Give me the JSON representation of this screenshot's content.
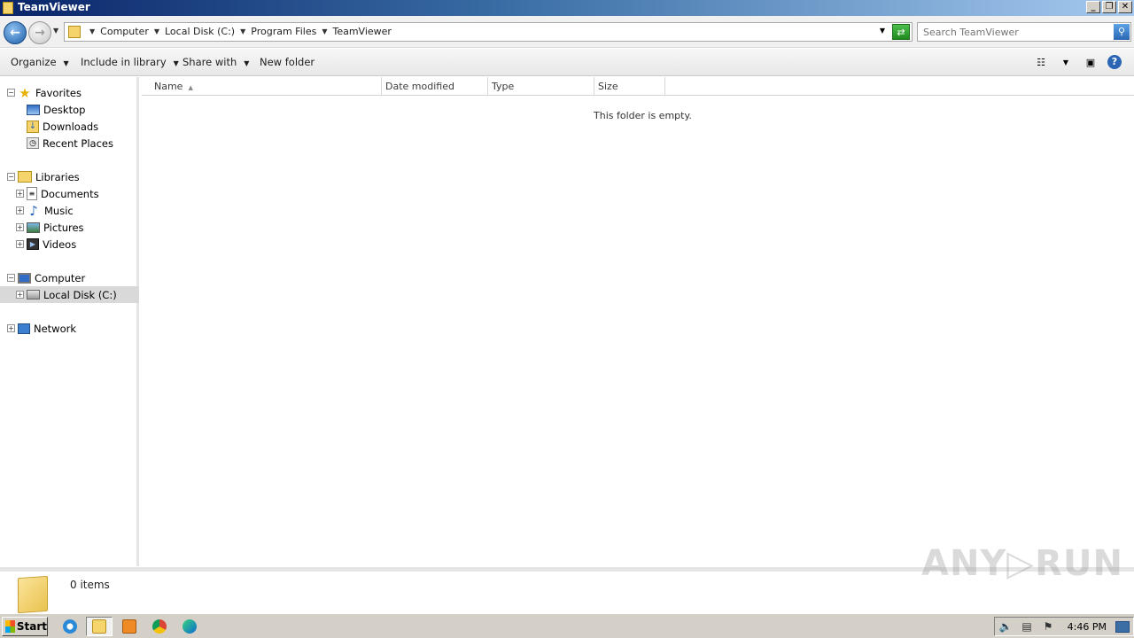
{
  "window": {
    "title": "TeamViewer",
    "buttons": {
      "minimize": "_",
      "restore": "❐",
      "close": "✕"
    }
  },
  "address": {
    "crumbs": [
      "Computer",
      "Local Disk (C:)",
      "Program Files",
      "TeamViewer"
    ],
    "search_placeholder": "Search TeamViewer"
  },
  "toolbar": {
    "organize": "Organize",
    "include_in_library": "Include in library",
    "share_with": "Share with",
    "new_folder": "New folder"
  },
  "nav": {
    "favorites": {
      "label": "Favorites",
      "items": [
        "Desktop",
        "Downloads",
        "Recent Places"
      ]
    },
    "libraries": {
      "label": "Libraries",
      "items": [
        "Documents",
        "Music",
        "Pictures",
        "Videos"
      ]
    },
    "computer": {
      "label": "Computer",
      "items": [
        "Local Disk (C:)"
      ]
    },
    "network": {
      "label": "Network"
    },
    "selected": "Local Disk (C:)"
  },
  "filelist": {
    "columns": [
      "Name",
      "Date modified",
      "Type",
      "Size"
    ],
    "empty_message": "This folder is empty."
  },
  "details": {
    "item_count": "0 items"
  },
  "watermark": "ANY▷RUN",
  "taskbar": {
    "start_label": "Start",
    "clock": "4:46 PM"
  },
  "colors": {
    "title_start": "#0a246a",
    "accent_blue": "#2a66b3",
    "selection_gray": "#d9d9d9"
  }
}
